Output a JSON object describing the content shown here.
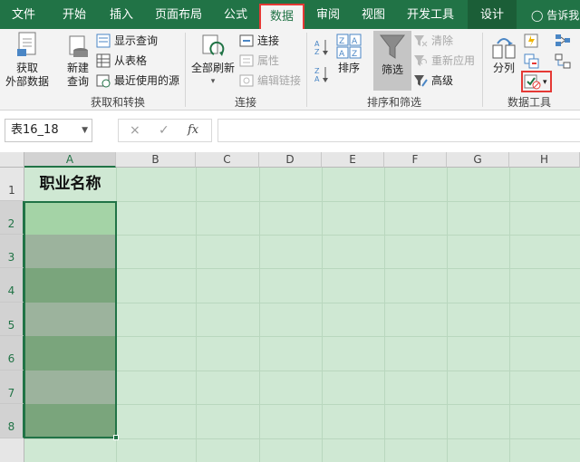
{
  "tabs": [
    {
      "label": "文件",
      "state": "normal"
    },
    {
      "label": "开始",
      "state": "normal"
    },
    {
      "label": "插入",
      "state": "normal"
    },
    {
      "label": "页面布局",
      "state": "normal"
    },
    {
      "label": "公式",
      "state": "normal"
    },
    {
      "label": "数据",
      "state": "active"
    },
    {
      "label": "审阅",
      "state": "normal"
    },
    {
      "label": "视图",
      "state": "normal"
    },
    {
      "label": "开发工具",
      "state": "normal"
    },
    {
      "label": "设计",
      "state": "contextual"
    }
  ],
  "tell_me": "告诉我",
  "ribbon": {
    "get_transform": {
      "group_label": "获取和转换",
      "get_external_line1": "获取",
      "get_external_line2": "外部数据",
      "new_query_line1": "新建",
      "new_query_line2": "查询",
      "show_queries": "显示查询",
      "from_table": "从表格",
      "recent_sources": "最近使用的源"
    },
    "connections": {
      "group_label": "连接",
      "refresh_all": "全部刷新",
      "connections": "连接",
      "properties": "属性",
      "edit_links": "编辑链接"
    },
    "sort_filter": {
      "group_label": "排序和筛选",
      "sort": "排序",
      "filter": "筛选",
      "clear": "清除",
      "reapply": "重新应用",
      "advanced": "高级"
    },
    "data_tools": {
      "group_label": "数据工具",
      "text_to_columns": "分列"
    }
  },
  "formula_bar": {
    "name_box": "表16_18",
    "cancel": "×",
    "enter": "✓",
    "fx": "fx",
    "value": ""
  },
  "sheet": {
    "columns": [
      "A",
      "B",
      "C",
      "D",
      "E",
      "F",
      "G",
      "H"
    ],
    "rows": [
      "1",
      "2",
      "3",
      "4",
      "5",
      "6",
      "7",
      "8"
    ],
    "a1": "职业名称",
    "selected_column": "A",
    "cell_fills": [
      "#a4d3a6",
      "#9cb39d",
      "#7aa57c",
      "#9cb39d",
      "#7aa57c",
      "#9cb39d",
      "#7aa57c"
    ]
  },
  "colors": {
    "brand": "#217346",
    "highlight": "#e53935"
  }
}
